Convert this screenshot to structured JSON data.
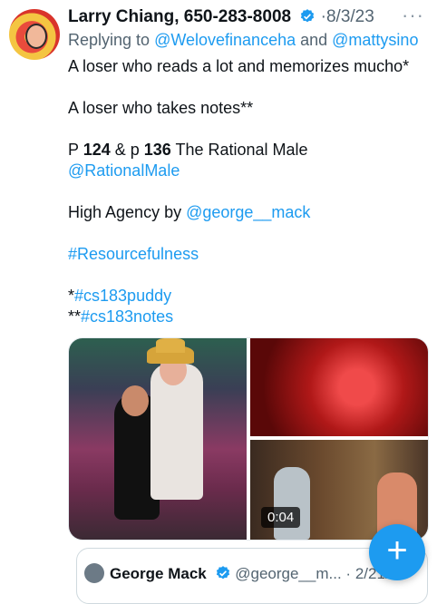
{
  "tweet": {
    "author_name": "Larry Chiang, 650-283-8008",
    "separator": "·",
    "date": "8/3/23",
    "more_label": "···",
    "reply_prefix": "Replying to ",
    "reply_user1": "@Welovefinanceha",
    "reply_and": " and ",
    "reply_user2": "@mattysino",
    "lines": {
      "l1": "A loser who reads a lot and memorizes mucho*",
      "l2": "A loser who takes notes**",
      "l3_p": "P ",
      "l3_n1": "124",
      "l3_mid": " & p ",
      "l3_n2": "136",
      "l3_end": " The Rational Male",
      "l4": "@RationalMale",
      "l5_text": "High Agency by ",
      "l5_link": "@george__mack",
      "l6": "#Resourcefulness",
      "l7_star": "*",
      "l7_tag": "#cs183puddy",
      "l8_star": "**",
      "l8_tag": "#cs183notes"
    },
    "video_duration": "0:04"
  },
  "quote": {
    "name": "George Mack",
    "handle": "@george__m...",
    "date": "2/21/2"
  },
  "fab_label": "+",
  "colors": {
    "link": "#1d9bf0",
    "verified": "#1d9bf0",
    "fab": "#1d9bf0",
    "secondary": "#536471"
  },
  "icons": {
    "verified": "verified-badge-icon",
    "compose": "plus-icon",
    "more": "more-dots-icon"
  }
}
